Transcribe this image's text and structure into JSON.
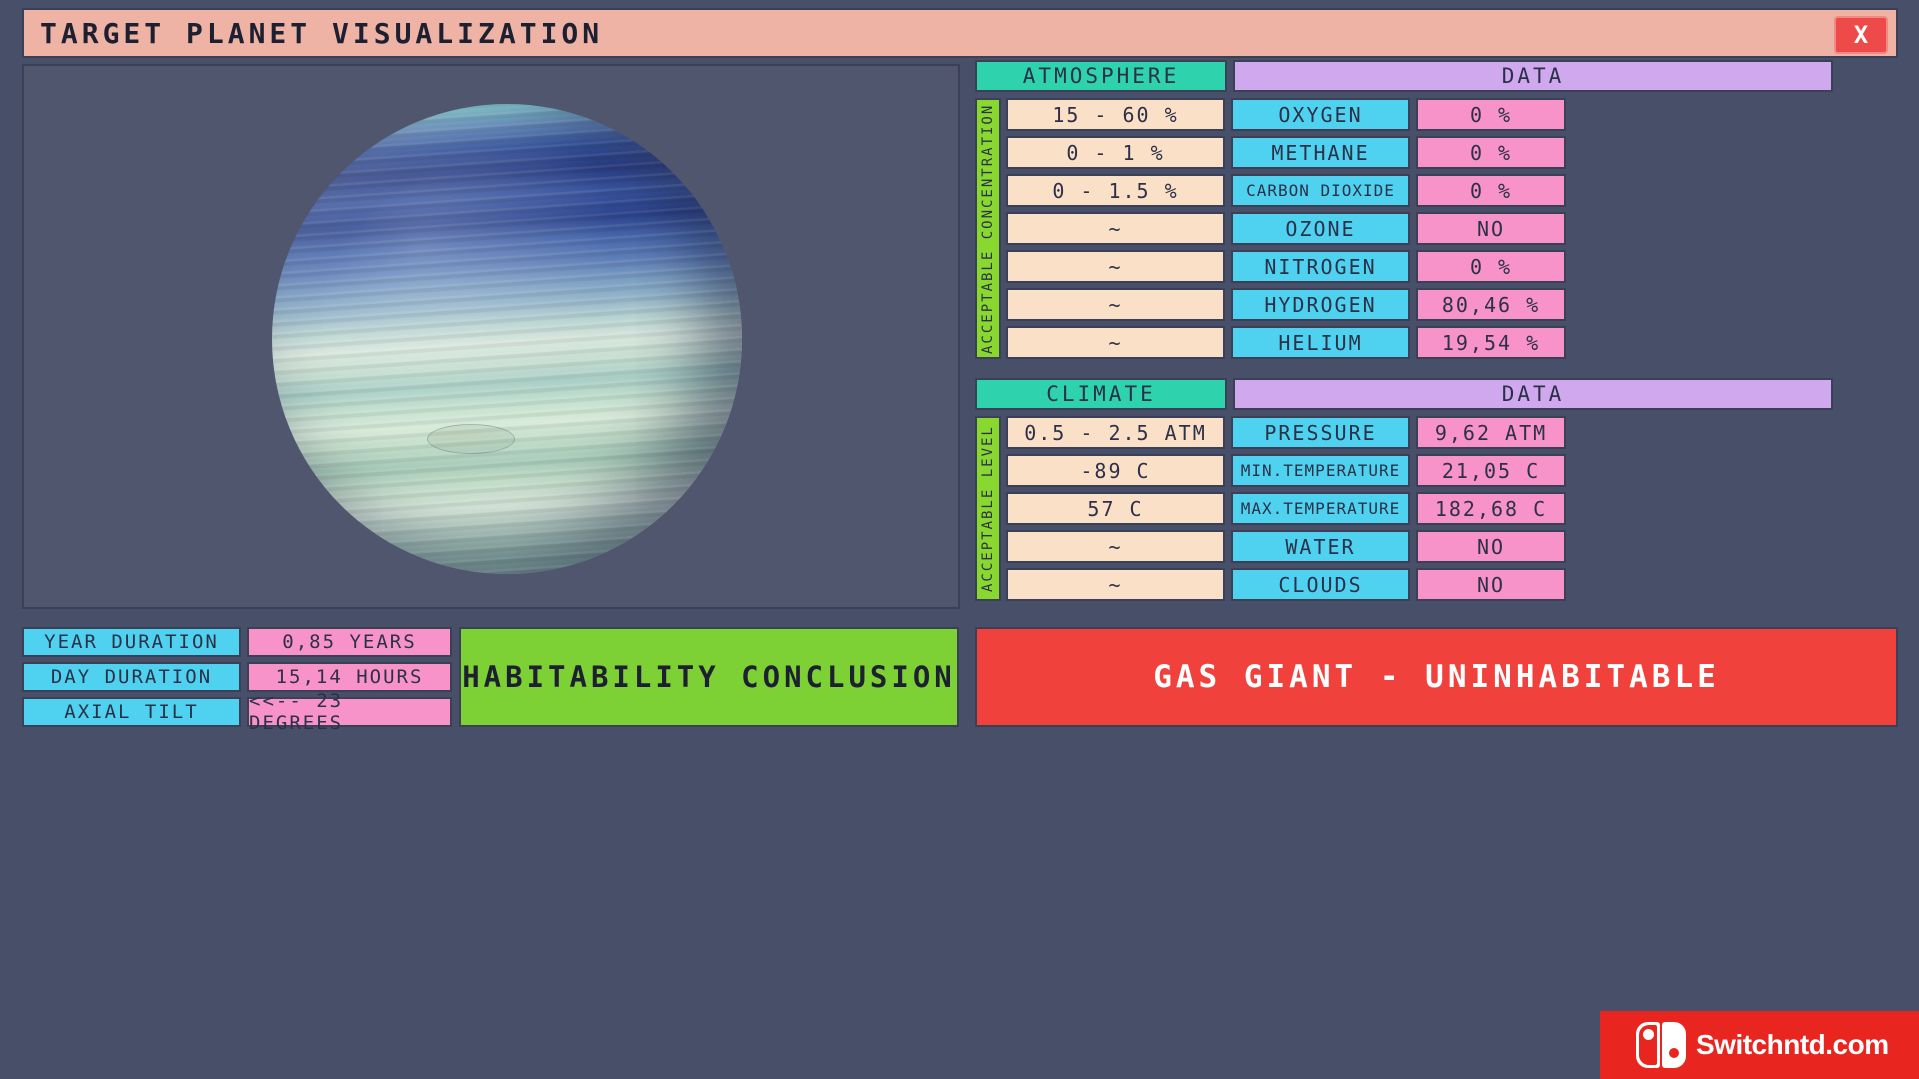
{
  "window": {
    "title": "TARGET PLANET VISUALIZATION",
    "close_label": "X",
    "bg_color": "#474f69",
    "titlebar_color": "#eeb3a4",
    "close_color": "#ef4a4a"
  },
  "viewport": {
    "name": "planet-render",
    "subject": "gas giant with blue and pale green cloud bands"
  },
  "atmosphere": {
    "head_left": "ATMOSPHERE",
    "head_right": "DATA",
    "vertical_label": "ACCEPTABLE CONCENTRATION",
    "rows": [
      {
        "range": "15 - 60 %",
        "name": "OXYGEN",
        "value": "0 %"
      },
      {
        "range": "0 - 1 %",
        "name": "METHANE",
        "value": "0 %"
      },
      {
        "range": "0 - 1.5 %",
        "name": "CARBON DIOXIDE",
        "value": "0 %"
      },
      {
        "range": "~",
        "name": "OZONE",
        "value": "NO"
      },
      {
        "range": "~",
        "name": "NITROGEN",
        "value": "0 %"
      },
      {
        "range": "~",
        "name": "HYDROGEN",
        "value": "80,46 %"
      },
      {
        "range": "~",
        "name": "HELIUM",
        "value": "19,54 %"
      }
    ]
  },
  "climate": {
    "head_left": "CLIMATE",
    "head_right": "DATA",
    "vertical_label": "ACCEPTABLE LEVEL",
    "rows": [
      {
        "range": "0.5 - 2.5 ATM",
        "name": "PRESSURE",
        "value": "9,62 ATM"
      },
      {
        "range": "-89 C",
        "name": "MIN.TEMPERATURE",
        "value": "21,05 C"
      },
      {
        "range": "57 C",
        "name": "MAX.TEMPERATURE",
        "value": "182,68 C"
      },
      {
        "range": "~",
        "name": "WATER",
        "value": "NO"
      },
      {
        "range": "~",
        "name": "CLOUDS",
        "value": "NO"
      }
    ]
  },
  "orbital_stats": [
    {
      "label": "YEAR DURATION",
      "value": "0,85 YEARS"
    },
    {
      "label": "DAY DURATION",
      "value": "15,14 HOURS"
    },
    {
      "label": "AXIAL TILT",
      "value": "<<-- 23 DEGREES"
    }
  ],
  "conclusion": {
    "title": "HABITABILITY CONCLUSION",
    "verdict": "GAS GIANT - UNINHABITABLE",
    "title_color": "#7ed135",
    "verdict_color": "#f1413c"
  },
  "watermark": {
    "text": "Switchntd.com",
    "color": "#e8251f"
  },
  "palette": {
    "teal_header": "#2ed3ad",
    "purple_header": "#cfa8ee",
    "green_label": "#88d830",
    "cream_cell": "#fbe0c8",
    "cyan_cell": "#4fd2ef",
    "pink_cell": "#f793c8",
    "border": "#3b4057"
  }
}
